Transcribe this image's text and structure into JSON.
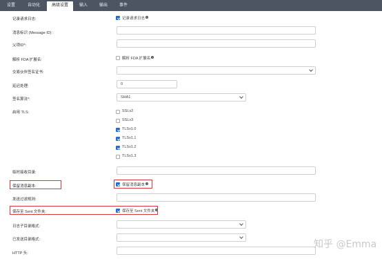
{
  "tabs": [
    "设置",
    "自动化",
    "高级设置",
    "输入",
    "输出",
    "事件"
  ],
  "rows": {
    "log_request_log": {
      "label": "记录请求日志:",
      "checkbox_label": "记录请求日志"
    },
    "message_id": {
      "label": "消息标识 (Message ID) :",
      "value": ""
    },
    "parent_id": {
      "label": "父项ID*:",
      "value": ""
    },
    "parse_fda": {
      "label": "解析 FDA 扩展名:",
      "checkbox_label": "解析 FDA 扩展名"
    },
    "sign_cert": {
      "label": "交易伙伴签名证书:",
      "value": ""
    },
    "delay": {
      "label": "延迟处理:",
      "value": "0"
    },
    "sign_algo": {
      "label": "签名算法*:",
      "value": "SHA1"
    },
    "tls": {
      "label": "启用 TLS:",
      "options": [
        {
          "label": "SSLv2",
          "checked": false
        },
        {
          "label": "SSLv3",
          "checked": false
        },
        {
          "label": "TLSv1.0",
          "checked": true
        },
        {
          "label": "TLSv1.1",
          "checked": true
        },
        {
          "label": "TLSv1.2",
          "checked": true
        },
        {
          "label": "TLSv1.3",
          "checked": false
        }
      ]
    },
    "temp_receive": {
      "label": "临时接收目录:",
      "value": ""
    },
    "keep_copy": {
      "label": "保留消息副本:",
      "checkbox_label": "保留消息副本"
    },
    "send_filter": {
      "label": "发送过滤规则:",
      "value": ""
    },
    "save_sent": {
      "label": "保存至 Sent 文件夹:",
      "checkbox_label": "保存至 Sent 文件夹"
    },
    "log_subdir": {
      "label": "日志子目录格式:",
      "value": ""
    },
    "sent_dir": {
      "label": "已发送目录格式:",
      "value": ""
    },
    "http_header": {
      "label": "HTTP 头:",
      "value": ""
    }
  },
  "watermark": "知乎 @Emma",
  "colors": {
    "tabbar": "#4d5563",
    "accent": "#1f6fd1",
    "highlight": "#d9363e"
  }
}
